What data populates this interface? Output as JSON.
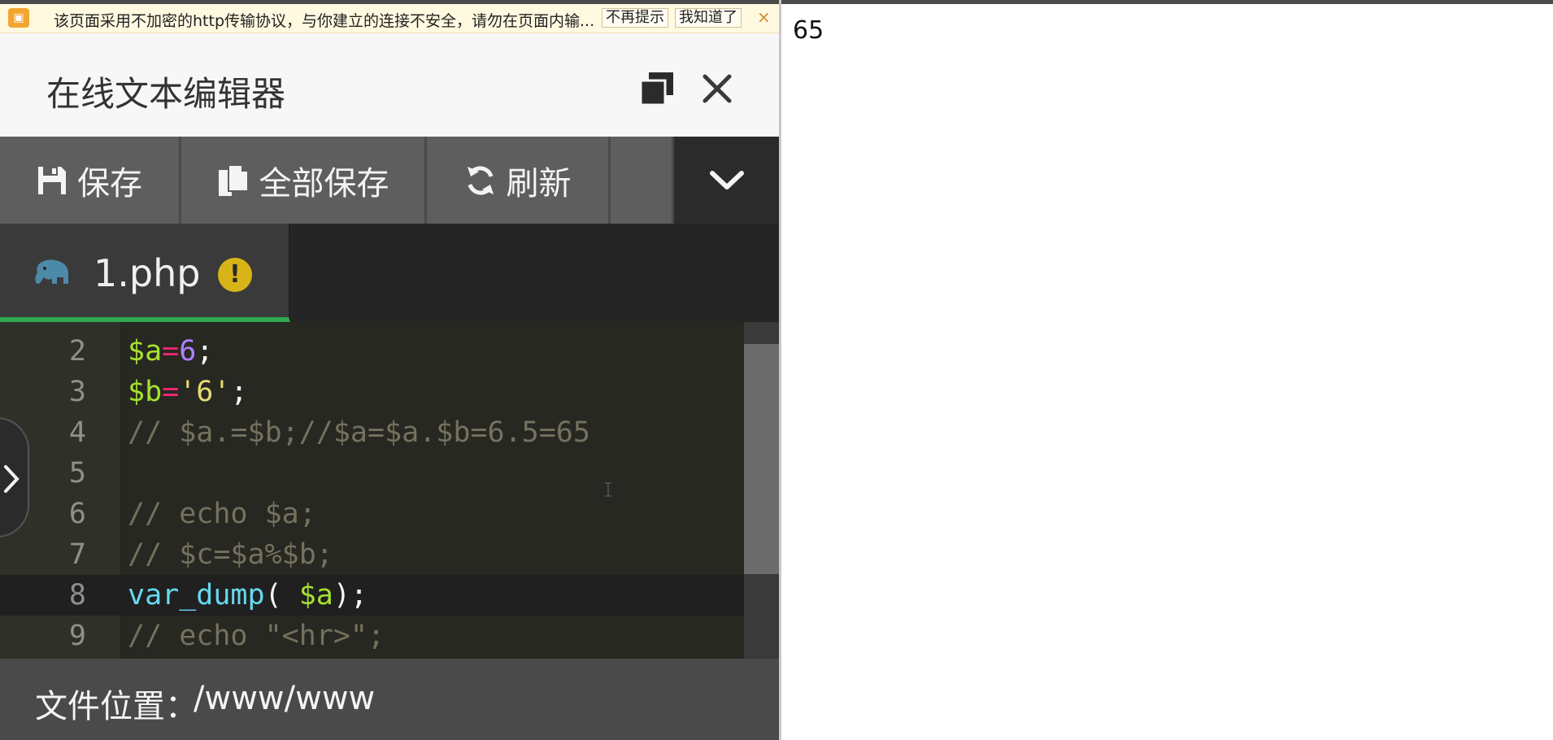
{
  "notice": {
    "text": "该页面采用不加密的http传输协议，与你建立的连接不安全，请勿在页面内输...",
    "no_remind": "不再提示",
    "got_it": "我知道了",
    "close": "×"
  },
  "window": {
    "title": "在线文本编辑器"
  },
  "toolbar": {
    "save": "保存",
    "save_all": "全部保存",
    "refresh": "刷新"
  },
  "tab": {
    "filename": "1.php",
    "warning": "!"
  },
  "editor": {
    "lines": [
      {
        "num": "2",
        "code": "$a=6;"
      },
      {
        "num": "3",
        "code": "$b='6';"
      },
      {
        "num": "4",
        "code": "// $a.=$b;//$a=$a.$b=6.5=65"
      },
      {
        "num": "5",
        "code": ""
      },
      {
        "num": "6",
        "code": "// echo $a;"
      },
      {
        "num": "7",
        "code": "// $c=$a%$b;"
      },
      {
        "num": "8",
        "code": "var_dump( $a);"
      },
      {
        "num": "9",
        "code": "// echo \"<hr>\";"
      }
    ],
    "active_line": "8"
  },
  "footer": {
    "label": "文件位置：",
    "path": "/www/www"
  },
  "output": {
    "text": "65"
  },
  "colors": {
    "accent_green": "#2fa84f",
    "warning_yellow": "#d8b418",
    "editor_bg": "#272822"
  }
}
